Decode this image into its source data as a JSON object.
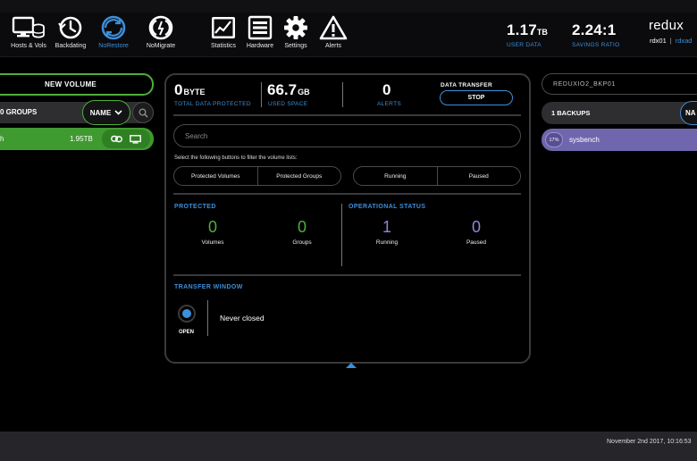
{
  "nav": [
    {
      "label": "Hosts & Vols",
      "icon": "hosts-vols-icon"
    },
    {
      "label": "Backdating",
      "icon": "backdating-clock-icon"
    },
    {
      "label": "NoRestore",
      "icon": "norestore-icon"
    },
    {
      "label": "NoMigrate",
      "icon": "nomigrate-icon"
    },
    {
      "label": "Statistics",
      "icon": "statistics-icon"
    },
    {
      "label": "Hardware",
      "icon": "hardware-icon"
    },
    {
      "label": "Settings",
      "icon": "gear-icon"
    },
    {
      "label": "Alerts",
      "icon": "alert-triangle-icon"
    }
  ],
  "nav_active": "NoRestore",
  "header": {
    "user_data_value": "1.17",
    "user_data_unit": "TB",
    "user_data_label": "USER DATA",
    "savings_value": "2.24:1",
    "savings_label": "SAVINGS RATIO",
    "brand": "redux",
    "host": "rdx01",
    "separator": "|",
    "link": "rdxad"
  },
  "left": {
    "new_volume": "NEW VOLUME",
    "groups_label": "0 GROUPS",
    "sort_label": "NAME",
    "volume": {
      "name": "h",
      "size": "1.95TB"
    }
  },
  "summary": {
    "protected_value": "0",
    "protected_unit": "BYTE",
    "protected_label": "TOTAL DATA PROTECTED",
    "used_value": "66.7",
    "used_unit": "GB",
    "used_label": "USED SPACE",
    "alerts_value": "0",
    "alerts_label": "ALERTS",
    "transfer_title": "DATA TRANSFER",
    "stop_label": "STOP"
  },
  "search": {
    "placeholder": "Search"
  },
  "filter_hint": "Select the following buttons to filter the volume lists:",
  "filters": {
    "protected_volumes": "Protected Volumes",
    "protected_groups": "Protected Groups",
    "running": "Running",
    "paused": "Paused"
  },
  "protected": {
    "title": "PROTECTED",
    "volumes_value": "0",
    "volumes_label": "Volumes",
    "groups_value": "0",
    "groups_label": "Groups"
  },
  "operational": {
    "title": "OPERATIONAL STATUS",
    "running_value": "1",
    "running_label": "Running",
    "paused_value": "0",
    "paused_label": "Paused"
  },
  "transfer_window": {
    "title": "TRANSFER WINDOW",
    "state": "OPEN",
    "status": "Never closed"
  },
  "right": {
    "server": "REDUXIO2_BKP01",
    "backups_label": "1 BACKUPS",
    "sort_label": "NA",
    "backup": {
      "badge": "17%",
      "name": "sysbench"
    }
  },
  "footer": {
    "datetime": "November 2nd 2017, 10:16:53"
  },
  "colors": {
    "accent_blue": "#3d8fd9",
    "green": "#4fae3b",
    "green_row": "#3f9a2f",
    "purple_row": "#6f66ad",
    "counter_green": "#4fae3b",
    "counter_purple": "#8f86d6"
  }
}
